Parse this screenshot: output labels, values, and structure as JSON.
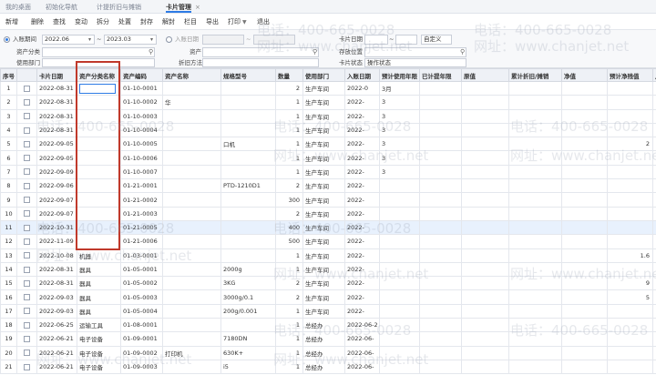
{
  "tabs": [
    {
      "label": "我的桌面"
    },
    {
      "label": "初始化导航"
    },
    {
      "label": "计提折旧与摊销"
    },
    {
      "label": "卡片管理"
    }
  ],
  "tab_close": "×",
  "toolbar": {
    "buttons": [
      "新增",
      "删除",
      "查找",
      "变动",
      "拆分",
      "处置",
      "封存",
      "解封",
      "栏目",
      "导出",
      "打印",
      "退出"
    ],
    "print_caret": "▼"
  },
  "filters": {
    "entry_period_label": "入账期间",
    "entry_period_from": "2022.06",
    "entry_period_to": "2023.03",
    "entry_date_label": "入账日期",
    "entry_date_from": "",
    "entry_date_to": "",
    "card_date_label": "卡片日期",
    "card_date_value": "",
    "card_date_mode": "自定义",
    "category_label": "资产分类",
    "asset_label": "资产",
    "location_label": "存放位置",
    "user_dept_label": "使用部门",
    "depr_method_label": "折旧方法",
    "card_status_label": "卡片状态",
    "card_status_value": "操作状态",
    "search_icon": "⚲",
    "dropdown_icon": "▾",
    "range_sep": "~"
  },
  "table": {
    "headers": [
      "序号",
      "",
      "卡片日期",
      "资产分类名称",
      "资产编码",
      "资产名称",
      "规格型号",
      "数量",
      "使用部门",
      "入账日期",
      "预计使用年限",
      "已计提年限",
      "原值",
      "累计折旧/摊销",
      "净值",
      "预计净残值",
      "月折旧"
    ],
    "rows": [
      [
        "1",
        "2022-08-31",
        "",
        "01-10-0001",
        "",
        "",
        "2",
        "生产车间",
        "2022-0",
        "3月",
        "",
        "",
        "",
        "",
        "",
        ""
      ],
      [
        "2",
        "2022-08-31",
        "",
        "01-10-0002",
        "华",
        "",
        "1",
        "生产车间",
        "2022-",
        "3",
        "",
        "",
        "",
        "",
        "",
        ""
      ],
      [
        "3",
        "2022-08-31",
        "",
        "01-10-0003",
        "",
        "",
        "1",
        "生产车间",
        "2022-",
        "3",
        "",
        "",
        "",
        "",
        "",
        ""
      ],
      [
        "4",
        "2022-08-31",
        "",
        "01-10-0004",
        "",
        "",
        "1",
        "生产车间",
        "2022-",
        "3",
        "",
        "",
        "",
        "",
        "",
        ""
      ],
      [
        "5",
        "2022-09-05",
        "",
        "01-10-0005",
        "",
        "口机",
        "1",
        "生产车间",
        "2022-",
        "3",
        "",
        "",
        "",
        "",
        "2",
        ""
      ],
      [
        "6",
        "2022-09-05",
        "",
        "01-10-0006",
        "",
        "",
        "1",
        "生产车间",
        "2022-",
        "3",
        "",
        "",
        "",
        "",
        "",
        ""
      ],
      [
        "7",
        "2022-09-09",
        "",
        "01-10-0007",
        "",
        "",
        "1",
        "生产车间",
        "2022-",
        "3",
        "",
        "",
        "",
        "",
        "",
        ""
      ],
      [
        "8",
        "2022-09-06",
        "",
        "01-21-0001",
        "",
        "PTD-1210D1",
        "2",
        "生产车间",
        "2022-",
        "",
        "",
        "",
        "",
        "",
        "",
        ""
      ],
      [
        "9",
        "2022-09-07",
        "",
        "01-21-0002",
        "",
        "",
        "300",
        "生产车间",
        "2022-",
        "",
        "",
        "",
        "",
        "",
        "",
        ""
      ],
      [
        "10",
        "2022-09-07",
        "",
        "01-21-0003",
        "",
        "",
        "2",
        "生产车间",
        "2022-",
        "",
        "",
        "",
        "",
        "",
        "",
        ""
      ],
      [
        "11",
        "2022-10-31",
        "",
        "01-21-0005",
        "",
        "",
        "400",
        "生产车间",
        "2022-",
        "",
        "",
        "",
        "",
        "",
        "",
        ""
      ],
      [
        "12",
        "2022-11-09",
        "",
        "01-21-0006",
        "",
        "",
        "500",
        "生产车间",
        "2022-",
        "",
        "",
        "",
        "",
        "",
        "",
        ""
      ],
      [
        "13",
        "2022-10-08",
        "机器",
        "01-03-0001",
        "",
        "",
        "1",
        "生产车间",
        "2022-",
        "",
        "",
        "",
        "",
        "",
        "1.6",
        ""
      ],
      [
        "14",
        "2022-08-31",
        "器具",
        "01-05-0001",
        "",
        "2000g",
        "1",
        "生产车间",
        "2022-",
        "",
        "",
        "",
        "",
        "",
        "",
        ""
      ],
      [
        "15",
        "2022-08-31",
        "器具",
        "01-05-0002",
        "",
        "3KG",
        "2",
        "生产车间",
        "2022-",
        "",
        "",
        "",
        "",
        "",
        "9",
        ""
      ],
      [
        "16",
        "2022-09-03",
        "器具",
        "01-05-0003",
        "",
        "3000g/0.1",
        "2",
        "生产车间",
        "2022-",
        "",
        "",
        "",
        "",
        "",
        "5",
        ""
      ],
      [
        "17",
        "2022-09-03",
        "器具",
        "01-05-0004",
        "",
        "200g/0.001",
        "1",
        "生产车间",
        "2022-",
        "",
        "",
        "",
        "",
        "",
        "",
        ""
      ],
      [
        "18",
        "2022-06-25",
        "运输工具",
        "01-08-0001",
        "",
        "",
        "1",
        "总经办",
        "2022-06-2",
        "",
        "",
        "",
        "",
        "",
        "",
        ""
      ],
      [
        "19",
        "2022-06-21",
        "电子设备",
        "01-09-0001",
        "",
        "7180DN",
        "1",
        "总经办",
        "2022-06-",
        "",
        "",
        "",
        "",
        "",
        "",
        ""
      ],
      [
        "20",
        "2022-06-21",
        "电子设备",
        "01-09-0002",
        "打印机",
        "630K+",
        "1",
        "总经办",
        "2022-06-",
        "",
        "",
        "",
        "",
        "",
        "",
        ""
      ],
      [
        "21",
        "2022-06-21",
        "电子设备",
        "01-09-0003",
        "",
        "i5",
        "1",
        "总经办",
        "2022-06-",
        "",
        "",
        "",
        "",
        "",
        "",
        ""
      ]
    ]
  },
  "watermark_lines": [
    "电话：400-665-0028",
    "网址：www.chanjet.net"
  ],
  "colors": {
    "accent": "#2d7be5",
    "highlight_box": "#c0392b",
    "selected_row": "#e8f1fd"
  }
}
